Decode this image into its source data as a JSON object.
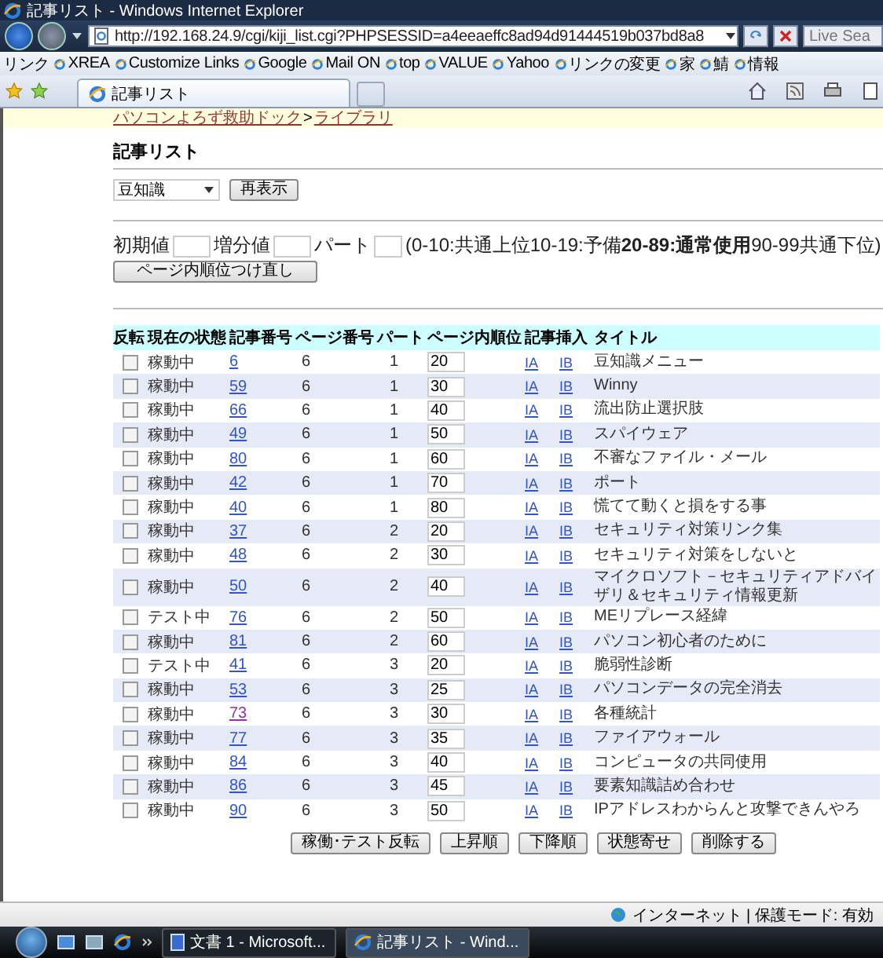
{
  "window": {
    "title": "記事リスト - Windows Internet Explorer"
  },
  "address_bar": {
    "url": "http://192.168.24.9/cgi/kiji_list.cgi?PHPSESSID=a4eeaeffc8ad94d91444519b037bd8a8",
    "search_placeholder": "Live Sea"
  },
  "links_bar": {
    "label": "リンク",
    "items": [
      "XREA",
      "Customize Links",
      "Google",
      "Mail ON",
      "top",
      "VALUE",
      "Yahoo",
      "リンクの変更",
      "家",
      "鯖",
      "情報"
    ]
  },
  "tabs": [
    {
      "label": "記事リスト",
      "selected": true
    }
  ],
  "page": {
    "breadcrumb": {
      "items": [
        "パソコンよろず救助ドック",
        "ライブラリ"
      ],
      "separator": ">"
    },
    "heading": "記事リスト",
    "category_select": "豆知識",
    "redisplay_button": "再表示",
    "fields": [
      "初期値",
      "増分値",
      "パート"
    ],
    "note": "(0-10:共通上位10-19:予備**20-89:通常使用**90-99共通下位)",
    "renumber_button": "ページ内順位つけ直し",
    "columns": [
      "反転",
      "現在の状態",
      "記事番号",
      "ページ番号",
      "パート",
      "ページ内順位",
      "記事挿入",
      "タイトル"
    ],
    "rows": [
      {
        "checked": false,
        "status": "稼動中",
        "number": "6",
        "visited": false,
        "page": "6",
        "part": "1",
        "order": "20",
        "insert_a": "IA",
        "insert_b": "IB",
        "title": "豆知識メニュー"
      },
      {
        "checked": false,
        "status": "稼動中",
        "number": "59",
        "visited": false,
        "page": "6",
        "part": "1",
        "order": "30",
        "insert_a": "IA",
        "insert_b": "IB",
        "title": "Winny"
      },
      {
        "checked": false,
        "status": "稼動中",
        "number": "66",
        "visited": false,
        "page": "6",
        "part": "1",
        "order": "40",
        "insert_a": "IA",
        "insert_b": "IB",
        "title": "流出防止選択肢"
      },
      {
        "checked": false,
        "status": "稼動中",
        "number": "49",
        "visited": false,
        "page": "6",
        "part": "1",
        "order": "50",
        "insert_a": "IA",
        "insert_b": "IB",
        "title": "スパイウェア"
      },
      {
        "checked": false,
        "status": "稼動中",
        "number": "80",
        "visited": false,
        "page": "6",
        "part": "1",
        "order": "60",
        "insert_a": "IA",
        "insert_b": "IB",
        "title": "不審なファイル・メール"
      },
      {
        "checked": false,
        "status": "稼動中",
        "number": "42",
        "visited": false,
        "page": "6",
        "part": "1",
        "order": "70",
        "insert_a": "IA",
        "insert_b": "IB",
        "title": "ポート"
      },
      {
        "checked": false,
        "status": "稼動中",
        "number": "40",
        "visited": false,
        "page": "6",
        "part": "1",
        "order": "80",
        "insert_a": "IA",
        "insert_b": "IB",
        "title": "慌てて動くと損をする事"
      },
      {
        "checked": false,
        "status": "稼動中",
        "number": "37",
        "visited": false,
        "page": "6",
        "part": "2",
        "order": "20",
        "insert_a": "IA",
        "insert_b": "IB",
        "title": "セキュリティ対策リンク集"
      },
      {
        "checked": false,
        "status": "稼動中",
        "number": "48",
        "visited": false,
        "page": "6",
        "part": "2",
        "order": "30",
        "insert_a": "IA",
        "insert_b": "IB",
        "title": "セキュリティ対策をしないと"
      },
      {
        "checked": false,
        "status": "稼動中",
        "number": "50",
        "visited": false,
        "page": "6",
        "part": "2",
        "order": "40",
        "insert_a": "IA",
        "insert_b": "IB",
        "title": "マイクロソフト－セキュリティアドバイザリ＆セキュリティ情報更新"
      },
      {
        "checked": false,
        "status": "テスト中",
        "number": "76",
        "visited": false,
        "page": "6",
        "part": "2",
        "order": "50",
        "insert_a": "IA",
        "insert_b": "IB",
        "title": "MEリプレース経緯"
      },
      {
        "checked": false,
        "status": "稼動中",
        "number": "81",
        "visited": false,
        "page": "6",
        "part": "2",
        "order": "60",
        "insert_a": "IA",
        "insert_b": "IB",
        "title": "パソコン初心者のために"
      },
      {
        "checked": false,
        "status": "テスト中",
        "number": "41",
        "visited": false,
        "page": "6",
        "part": "3",
        "order": "20",
        "insert_a": "IA",
        "insert_b": "IB",
        "title": "脆弱性診断"
      },
      {
        "checked": false,
        "status": "稼動中",
        "number": "53",
        "visited": false,
        "page": "6",
        "part": "3",
        "order": "25",
        "insert_a": "IA",
        "insert_b": "IB",
        "title": "パソコンデータの完全消去"
      },
      {
        "checked": false,
        "status": "稼動中",
        "number": "73",
        "visited": true,
        "page": "6",
        "part": "3",
        "order": "30",
        "insert_a": "IA",
        "insert_b": "IB",
        "title": "各種統計"
      },
      {
        "checked": false,
        "status": "稼動中",
        "number": "77",
        "visited": false,
        "page": "6",
        "part": "3",
        "order": "35",
        "insert_a": "IA",
        "insert_b": "IB",
        "title": "ファイアウォール"
      },
      {
        "checked": false,
        "status": "稼動中",
        "number": "84",
        "visited": false,
        "page": "6",
        "part": "3",
        "order": "40",
        "insert_a": "IA",
        "insert_b": "IB",
        "title": "コンピュータの共同使用"
      },
      {
        "checked": false,
        "status": "稼動中",
        "number": "86",
        "visited": false,
        "page": "6",
        "part": "3",
        "order": "45",
        "insert_a": "IA",
        "insert_b": "IB",
        "title": "要素知識詰め合わせ"
      },
      {
        "checked": false,
        "status": "稼動中",
        "number": "90",
        "visited": false,
        "page": "6",
        "part": "3",
        "order": "50",
        "insert_a": "IA",
        "insert_b": "IB",
        "title": "IPアドレスわからんと攻撃できんやろ"
      }
    ],
    "action_buttons": [
      "稼働･テスト反転",
      "上昇順",
      "下降順",
      "状態寄せ",
      "削除する"
    ]
  },
  "status_bar": {
    "zone": "インターネット | 保護モード: 有効"
  },
  "taskbar": {
    "items": [
      {
        "label": "文書 1 - Microsoft...",
        "selected": false
      },
      {
        "label": "記事リスト - Wind...",
        "selected": true
      }
    ]
  }
}
